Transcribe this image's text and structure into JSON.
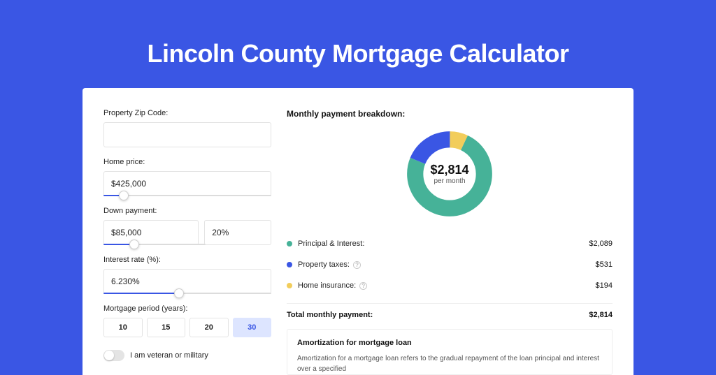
{
  "title": "Lincoln County Mortgage Calculator",
  "form": {
    "zip_label": "Property Zip Code:",
    "zip_value": "",
    "home_price_label": "Home price:",
    "home_price_value": "$425,000",
    "home_price_pct": 12,
    "down_label": "Down payment:",
    "down_value": "$85,000",
    "down_pct_value": "20%",
    "down_slider_pct": 30,
    "rate_label": "Interest rate (%):",
    "rate_value": "6.230%",
    "rate_slider_pct": 45,
    "period_label": "Mortgage period (years):",
    "periods": [
      {
        "label": "10",
        "selected": false
      },
      {
        "label": "15",
        "selected": false
      },
      {
        "label": "20",
        "selected": false
      },
      {
        "label": "30",
        "selected": true
      }
    ],
    "veteran_label": "I am veteran or military",
    "veteran_on": false
  },
  "breakdown": {
    "title": "Monthly payment breakdown:",
    "center_amount": "$2,814",
    "center_sub": "per month",
    "items": [
      {
        "key": "principal_interest",
        "label": "Principal & Interest:",
        "value": "$2,089",
        "color": "#46b298",
        "pct": 74.2,
        "has_info": false
      },
      {
        "key": "property_taxes",
        "label": "Property taxes:",
        "value": "$531",
        "color": "#3a56e4",
        "pct": 18.9,
        "has_info": true
      },
      {
        "key": "home_insurance",
        "label": "Home insurance:",
        "value": "$194",
        "color": "#f2cd5b",
        "pct": 6.9,
        "has_info": true
      }
    ],
    "total_label": "Total monthly payment:",
    "total_value": "$2,814"
  },
  "amortization": {
    "title": "Amortization for mortgage loan",
    "text": "Amortization for a mortgage loan refers to the gradual repayment of the loan principal and interest over a specified"
  }
}
